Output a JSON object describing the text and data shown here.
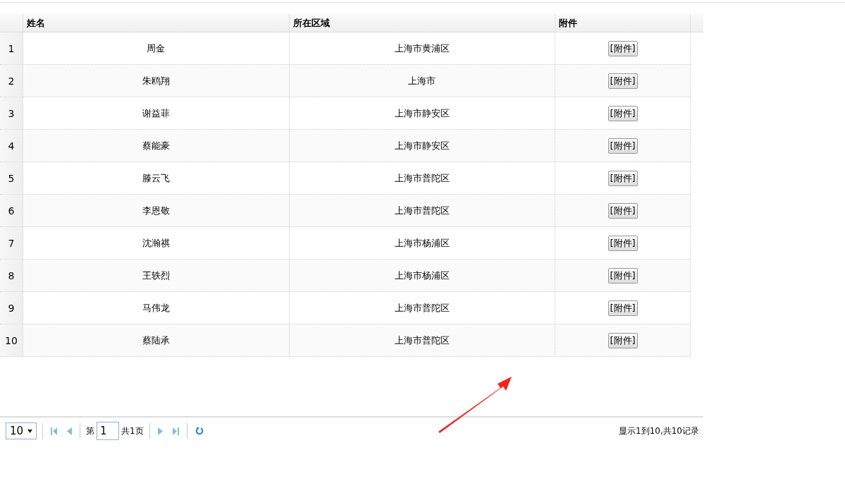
{
  "table": {
    "columns": [
      "姓名",
      "所在区域",
      "附件"
    ],
    "rows": [
      {
        "index": "1",
        "name": "周金",
        "region": "上海市黄浦区",
        "attachment": "[附件]"
      },
      {
        "index": "2",
        "name": "朱鸥翔",
        "region": "上海市",
        "attachment": "[附件]"
      },
      {
        "index": "3",
        "name": "谢益菲",
        "region": "上海市静安区",
        "attachment": "[附件]"
      },
      {
        "index": "4",
        "name": "蔡能豪",
        "region": "上海市静安区",
        "attachment": "[附件]"
      },
      {
        "index": "5",
        "name": "滕云飞",
        "region": "上海市普陀区",
        "attachment": "[附件]"
      },
      {
        "index": "6",
        "name": "李恩敬",
        "region": "上海市普陀区",
        "attachment": "[附件]"
      },
      {
        "index": "7",
        "name": "沈瀚祺",
        "region": "上海市杨浦区",
        "attachment": "[附件]"
      },
      {
        "index": "8",
        "name": "王轶烈",
        "region": "上海市杨浦区",
        "attachment": "[附件]"
      },
      {
        "index": "9",
        "name": "马伟龙",
        "region": "上海市普陀区",
        "attachment": "[附件]"
      },
      {
        "index": "10",
        "name": "蔡陆承",
        "region": "上海市普陀区",
        "attachment": "[附件]"
      }
    ]
  },
  "pager": {
    "page_size": "10",
    "page_label": "第",
    "page": "1",
    "total_pages": "共1页",
    "summary": "显示1到10,共10记录"
  }
}
